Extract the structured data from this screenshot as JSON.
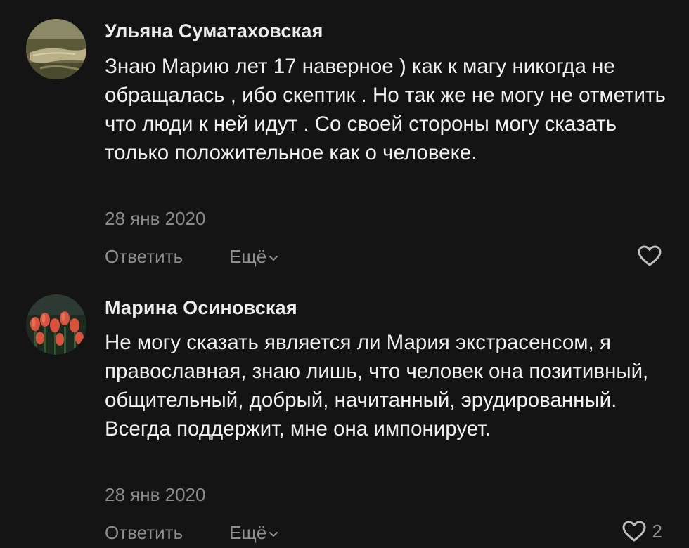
{
  "comments": [
    {
      "author": "Ульяна Суматаховская",
      "text": "Знаю Марию лет 17 наверное ) как к магу никогда не обращалась , ибо скептик . Но так же не могу не отметить что люди к ней идут . Со своей стороны могу сказать только положительное как о человеке.",
      "date": "28 янв 2020",
      "reply_label": "Ответить",
      "more_label": "Ещё",
      "likes": "",
      "avatar_icon": "photo-avatar"
    },
    {
      "author": "Марина Осиновская",
      "text": "Не могу сказать является ли Мария экстрасенсом, я православная, знаю лишь, что человек она позитивный, общительный, добрый, начитанный, эрудированный. Всегда поддержит, мне она импонирует.",
      "date": "28 янв 2020",
      "reply_label": "Ответить",
      "more_label": "Ещё",
      "likes": "2",
      "avatar_icon": "tulips-avatar"
    }
  ],
  "colors": {
    "background": "#141414",
    "text": "#f0f0f0",
    "muted": "#8e8e8e"
  }
}
